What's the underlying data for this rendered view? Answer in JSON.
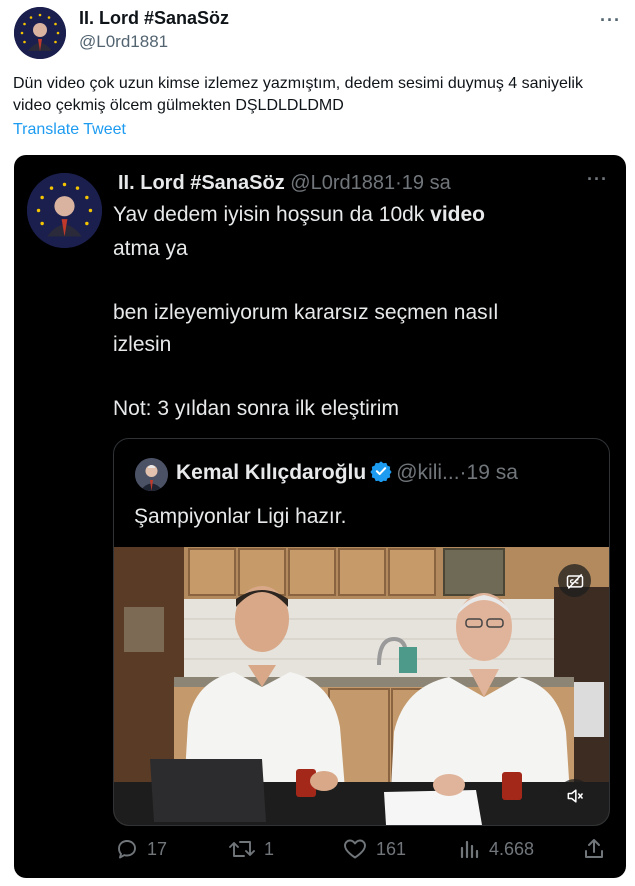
{
  "outer_tweet": {
    "display_name": "II. Lord #SanaSöz",
    "handle": "@L0rd1881",
    "more_label": "···",
    "text": "Dün video çok uzun kimse izlemez yazmıştım, dedem sesimi duymuş 4 saniyelik video çekmiş ölcem gülmekten DŞLDLDLDMD",
    "translate_label": "Translate Tweet"
  },
  "embedded_tweet": {
    "display_name": "II. Lord #SanaSöz",
    "handle": "@L0rd1881",
    "separator": "·",
    "time": "19 sa",
    "more_label": "···",
    "line1_before": "Yav dedem iyisin hoşsun da 10dk ",
    "line1_bold": "video",
    "line2": "atma ya",
    "para2_line1": "ben izleyemiyorum kararsız seçmen nasıl",
    "para2_line2": "izlesin",
    "para3": "Not: 3 yıldan sonra ilk eleştirim",
    "quoted": {
      "display_name": "Kemal Kılıçdaroğlu",
      "handle": "@kili...",
      "separator": "·",
      "time": "19 sa",
      "text": "Şampiyonlar Ligi hazır."
    },
    "stats": {
      "replies": "17",
      "retweets": "1",
      "likes": "161",
      "views": "4.668"
    }
  },
  "colors": {
    "link_blue": "#1d9bf0",
    "card_bg": "#000000",
    "text_dark": "#0f1419",
    "text_muted": "#536471",
    "dark_text": "#e7e9ea",
    "dark_muted": "#71767b"
  },
  "icons": [
    "more-icon",
    "verified-icon",
    "caption-off-icon",
    "mute-icon",
    "reply-icon",
    "retweet-icon",
    "like-icon",
    "views-icon",
    "share-icon"
  ]
}
